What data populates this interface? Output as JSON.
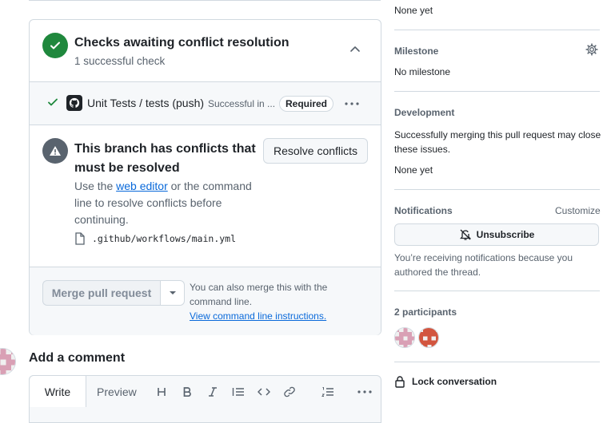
{
  "checks": {
    "title": "Checks awaiting conflict resolution",
    "summary": "1 successful check",
    "row": {
      "name": "Unit Tests / tests (push)",
      "status": "Successful in ...",
      "badge": "Required"
    }
  },
  "conflicts": {
    "title": "This branch has conflicts that must be resolved",
    "body_prefix": "Use the ",
    "body_link": "web editor",
    "body_suffix": " or the command line to resolve conflicts before continuing.",
    "resolve_button": "Resolve conflicts",
    "file": ".github/workflows/main.yml"
  },
  "merge": {
    "button": "Merge pull request",
    "note": "You can also merge this with the command line.",
    "link": "View command line instructions."
  },
  "comment": {
    "heading": "Add a comment",
    "tabs": [
      "Write",
      "Preview"
    ],
    "toolbar_icons": [
      "heading-icon",
      "bold-icon",
      "italic-icon",
      "quote-icon",
      "code-icon",
      "link-icon",
      "ordered-list-icon",
      "more-icon"
    ]
  },
  "sidebar": {
    "reviewers_value": "None yet",
    "milestone": {
      "heading": "Milestone",
      "value": "No milestone"
    },
    "development": {
      "heading": "Development",
      "text": "Successfully merging this pull request may close these issues.",
      "value": "None yet"
    },
    "notifications": {
      "heading": "Notifications",
      "customize": "Customize",
      "button": "Unsubscribe",
      "text": "You’re receiving notifications because you authored the thread."
    },
    "participants": {
      "heading": "2 participants"
    },
    "lock": "Lock conversation"
  },
  "colors": {
    "success": "#1f883d",
    "link": "#0969da",
    "muted": "#59636e",
    "border": "#d1d9e0"
  }
}
